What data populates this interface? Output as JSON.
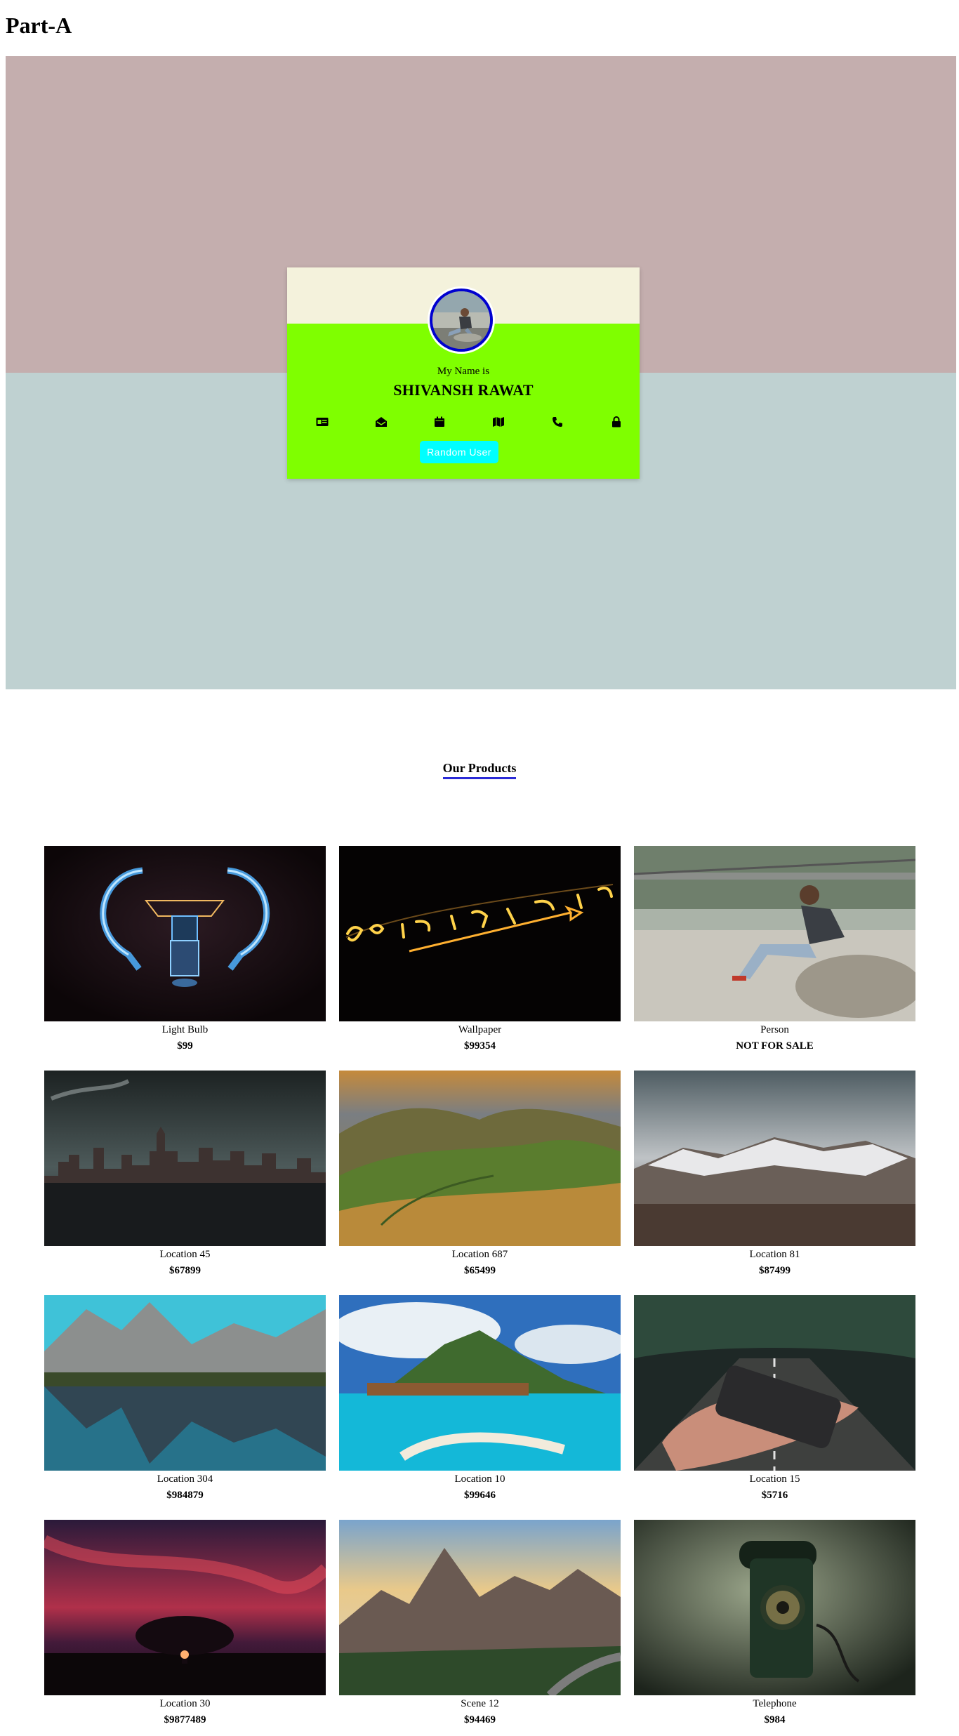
{
  "page": {
    "heading": "Part-A"
  },
  "hero": {
    "top_color": "#c4aeae",
    "bottom_color": "#bfd1d1"
  },
  "profile_card": {
    "label": "My Name is",
    "name": "SHIVANSH RAWAT",
    "background": "#7fff00",
    "header_color": "#f4f2dc",
    "icons": [
      "id-card-icon",
      "envelope-open-icon",
      "calendar-icon",
      "map-icon",
      "phone-icon",
      "lock-icon"
    ],
    "button_label": "Random User",
    "button_color": "#00ffff"
  },
  "products": {
    "title": "Our Products",
    "underline_color": "#2a2ad6",
    "items": [
      {
        "name": "Light Bulb",
        "price": "$99",
        "image": "light-bulb-image"
      },
      {
        "name": "Wallpaper",
        "price": "$99354",
        "image": "neon-sign-image"
      },
      {
        "name": "Person",
        "price": "NOT FOR SALE",
        "image": "person-on-rock-image"
      },
      {
        "name": "Location 45",
        "price": "$67899",
        "image": "city-skyline-image"
      },
      {
        "name": "Location 687",
        "price": "$65499",
        "image": "green-hills-image"
      },
      {
        "name": "Location 81",
        "price": "$87499",
        "image": "snowy-mountain-image"
      },
      {
        "name": "Location 304",
        "price": "$984879",
        "image": "lake-mountain-image"
      },
      {
        "name": "Location 10",
        "price": "$99646",
        "image": "tropical-island-image"
      },
      {
        "name": "Location 15",
        "price": "$5716",
        "image": "phone-road-image"
      },
      {
        "name": "Location 30",
        "price": "$9877489",
        "image": "sunset-tree-image"
      },
      {
        "name": "Scene 12",
        "price": "$94469",
        "image": "alpine-valley-image"
      },
      {
        "name": "Telephone",
        "price": "$984",
        "image": "rotary-telephone-image"
      }
    ]
  }
}
